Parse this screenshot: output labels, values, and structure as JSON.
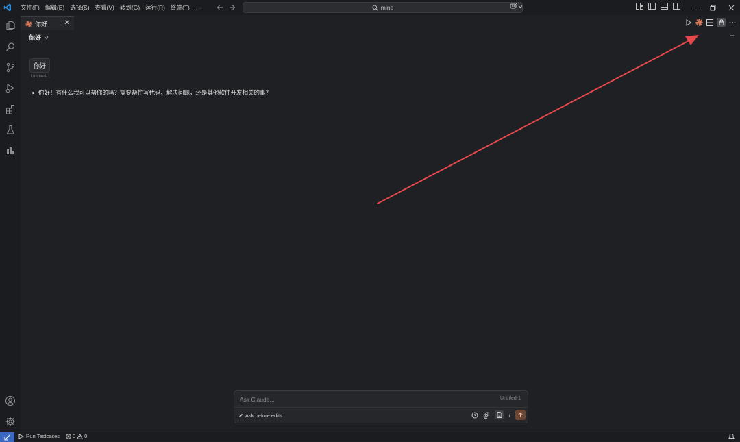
{
  "titlebar": {
    "menu": [
      "文件(F)",
      "编辑(E)",
      "选择(S)",
      "查看(V)",
      "转到(G)",
      "运行(R)",
      "终端(T)",
      "···"
    ],
    "search_text": "mine"
  },
  "tab": {
    "label": "你好"
  },
  "conversation": {
    "title": "你好",
    "user_message": "你好",
    "message_ref": "Untitled-1",
    "assistant_reply": "你好！有什么我可以帮你的吗？需要帮忙写代码、解决问题，还是其他软件开发相关的事？"
  },
  "composer": {
    "placeholder": "Ask Claude...",
    "file_context": "Untitled-1",
    "mode_label": "Ask before edits",
    "slash": "/"
  },
  "statusbar": {
    "run_label": "Run Testcases",
    "errors": "0",
    "warnings": "0"
  },
  "colors": {
    "background": "#1f2023",
    "accent_blue": "#3b69c2",
    "claude_orange": "#d97757",
    "annotation_red": "#e5484d"
  }
}
